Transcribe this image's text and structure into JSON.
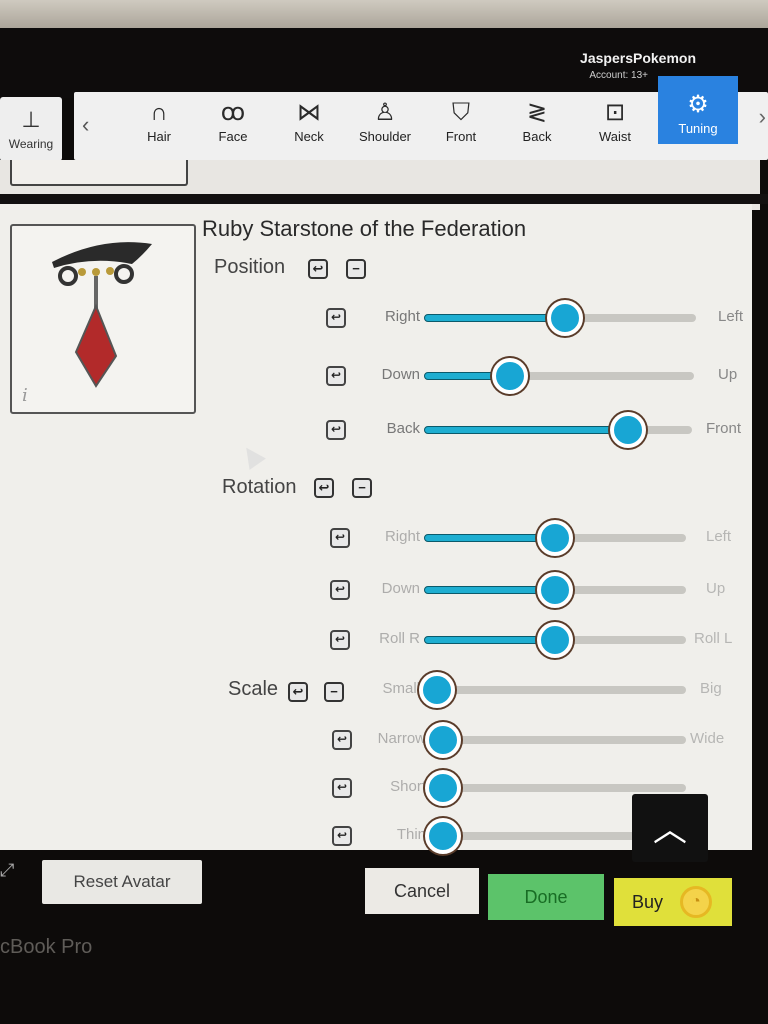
{
  "header": {
    "username": "JaspersPokemon",
    "account": "Account: 13+"
  },
  "wearing_tab": {
    "label": "Wearing",
    "icon": "hat-icon"
  },
  "categories": [
    {
      "label": "Hair",
      "icon": "hair-icon",
      "glyph": "∩"
    },
    {
      "label": "Face",
      "icon": "face-icon",
      "glyph": "ꝏ"
    },
    {
      "label": "Neck",
      "icon": "bowtie-icon",
      "glyph": "⋈"
    },
    {
      "label": "Shoulder",
      "icon": "shoulder-icon",
      "glyph": "♙"
    },
    {
      "label": "Front",
      "icon": "front-icon",
      "glyph": "⛉"
    },
    {
      "label": "Back",
      "icon": "wings-icon",
      "glyph": "≷"
    },
    {
      "label": "Waist",
      "icon": "belt-icon",
      "glyph": "⊡"
    },
    {
      "label": "Tuning",
      "icon": "gear-icon",
      "glyph": "⚙",
      "active": true
    }
  ],
  "item": {
    "title": "Ruby Starstone of the Federation",
    "info_icon": "i"
  },
  "sections": {
    "position": {
      "title": "Position",
      "sliders": [
        {
          "left": "Right",
          "right": "Left",
          "value": 0.49
        },
        {
          "left": "Down",
          "right": "Up",
          "value": 0.29
        },
        {
          "left": "Back",
          "right": "Front",
          "value": 0.73
        }
      ]
    },
    "rotation": {
      "title": "Rotation",
      "sliders": [
        {
          "left": "Right",
          "right": "Left",
          "value": 0.47
        },
        {
          "left": "Down",
          "right": "Up",
          "value": 0.47
        },
        {
          "left": "Roll R",
          "right": "Roll L",
          "value": 0.47
        }
      ]
    },
    "scale": {
      "title": "Scale",
      "sliders": [
        {
          "left": "Small",
          "right": "Big",
          "value": 0.02
        },
        {
          "left": "Narrow",
          "right": "Wide",
          "value": 0.02
        },
        {
          "left": "Short",
          "right": "",
          "value": 0.02
        },
        {
          "left": "Thin",
          "right": "",
          "value": 0.02
        }
      ]
    }
  },
  "buttons": {
    "reset_avatar": "Reset Avatar",
    "cancel": "Cancel",
    "done": "Done",
    "buy": "Buy",
    "reset_glyph": "↩",
    "collapse_glyph": "−",
    "scroll_up_glyph": "︿",
    "prev_glyph": "‹",
    "next_glyph": "›"
  },
  "device_label": "cBook Pro",
  "colors": {
    "accent": "#2a82e0",
    "slider_fill": "#1eaed1",
    "done": "#5cc36a",
    "buy": "#e0e03a"
  }
}
